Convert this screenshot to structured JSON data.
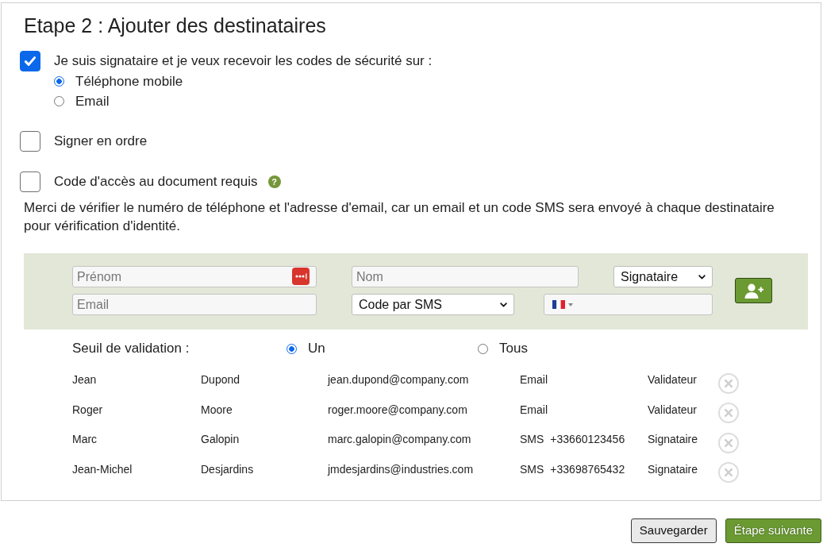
{
  "title": "Etape 2 : Ajouter des destinataires",
  "options": [
    {
      "label": "Je suis signataire et je veux recevoir les codes de sécurité sur :",
      "checked": true,
      "radios": [
        {
          "label": "Téléphone mobile",
          "selected": true
        },
        {
          "label": "Email",
          "selected": false
        }
      ]
    },
    {
      "label": "Signer en ordre",
      "checked": false
    },
    {
      "label": "Code d'accès au document requis",
      "checked": false,
      "help": "?"
    }
  ],
  "notice": "Merci de vérifier le numéro de téléphone et l'adresse d'email, car un email et un code SMS sera envoyé à chaque destinataire pour vérification d'identité.",
  "entry_form": {
    "first_name": {
      "placeholder": "Prénom"
    },
    "last_name": {
      "placeholder": "Nom"
    },
    "role": {
      "value": "Signataire"
    },
    "email": {
      "placeholder": "Email"
    },
    "delivery": {
      "value": "Code par SMS"
    }
  },
  "threshold": {
    "label": "Seuil de validation :",
    "options": [
      {
        "label": "Un",
        "selected": true
      },
      {
        "label": "Tous",
        "selected": false
      }
    ]
  },
  "recipients": [
    {
      "first_name": "Jean",
      "last_name": "Dupond",
      "email": "jean.dupond@company.com",
      "method": "Email",
      "role": "Validateur"
    },
    {
      "first_name": "Roger",
      "last_name": "Moore",
      "email": "roger.moore@company.com",
      "method": "Email",
      "role": "Validateur"
    },
    {
      "first_name": "Marc",
      "last_name": "Galopin",
      "email": "marc.galopin@company.com",
      "method": "SMS",
      "phone": "+33660123456",
      "role": "Signataire"
    },
    {
      "first_name": "Jean-Michel",
      "last_name": "Desjardins",
      "email": "jmdesjardins@industries.com",
      "method": "SMS",
      "phone": "+33698765432",
      "role": "Signataire"
    }
  ],
  "buttons": [
    {
      "label": "Sauvegarder",
      "kind": "save"
    },
    {
      "label": "Étape suivante",
      "kind": "next"
    }
  ]
}
